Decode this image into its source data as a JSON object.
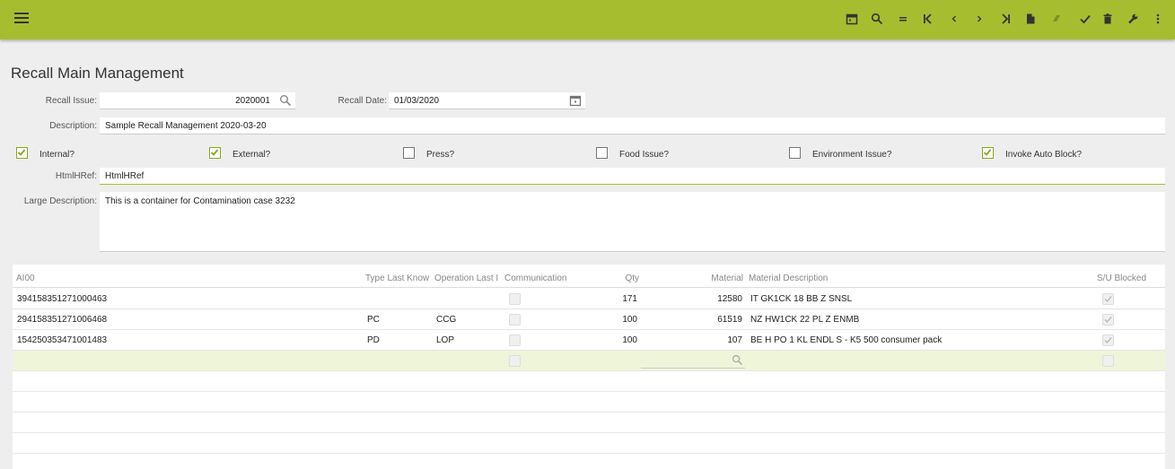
{
  "app": {
    "page_title": "Recall Main Management"
  },
  "toolbar": {
    "items": [
      {
        "name": "calendar-icon"
      },
      {
        "name": "search-icon"
      },
      {
        "name": "equals-icon"
      },
      {
        "name": "first-record-icon"
      },
      {
        "name": "previous-record-icon"
      },
      {
        "name": "next-record-icon"
      },
      {
        "name": "last-record-icon"
      },
      {
        "name": "new-document-icon"
      },
      {
        "name": "eraser-icon"
      },
      {
        "name": "save-check-icon"
      },
      {
        "name": "delete-icon"
      },
      {
        "name": "wrench-icon"
      },
      {
        "name": "more-vert-icon"
      }
    ]
  },
  "form": {
    "recall_issue": {
      "label": "Recall Issue:",
      "value": "2020001"
    },
    "recall_date": {
      "label": "Recall Date:",
      "value": "01/03/2020"
    },
    "description": {
      "label": "Description:",
      "value": "Sample Recall Management 2020-03-20"
    },
    "checkboxes": [
      {
        "label": "Internal?",
        "checked": true
      },
      {
        "label": "External?",
        "checked": true
      },
      {
        "label": "Press?",
        "checked": false
      },
      {
        "label": "Food Issue?",
        "checked": false
      },
      {
        "label": "Environment Issue?",
        "checked": false
      },
      {
        "label": "Invoke Auto Block?",
        "checked": true
      }
    ],
    "htmlhref": {
      "label": "HtmlHRef:",
      "value": "HtmlHRef"
    },
    "large_description": {
      "label": "Large Description:",
      "value": "This is a container for Contamination case 3232"
    }
  },
  "grid": {
    "columns": {
      "ai00": "AI00",
      "type": "Type Last Know",
      "operation": "Operation Last I",
      "communication": "Communication",
      "qty": "Qty",
      "material": "Material",
      "material_description": "Material Description",
      "su_blocked": "S/U Blocked"
    },
    "rows": [
      {
        "ai00": "394158351271000463",
        "type": "",
        "operation": "",
        "qty": "171",
        "material": "12580",
        "material_description": "IT GK1CK 18 BB Z SNSL"
      },
      {
        "ai00": "294158351271006468",
        "type": "PC",
        "operation": "CCG",
        "qty": "100",
        "material": "61519",
        "material_description": "NZ HW1CK 22 PL Z ENMB"
      },
      {
        "ai00": "154250353471001483",
        "type": "PD",
        "operation": "LOP",
        "qty": "100",
        "material": "107",
        "material_description": "BE H PO 1 KL ENDL S - K5 500 consumer pack"
      }
    ]
  },
  "colors": {
    "accent": "#a7bd30",
    "background": "#eeeeee"
  }
}
